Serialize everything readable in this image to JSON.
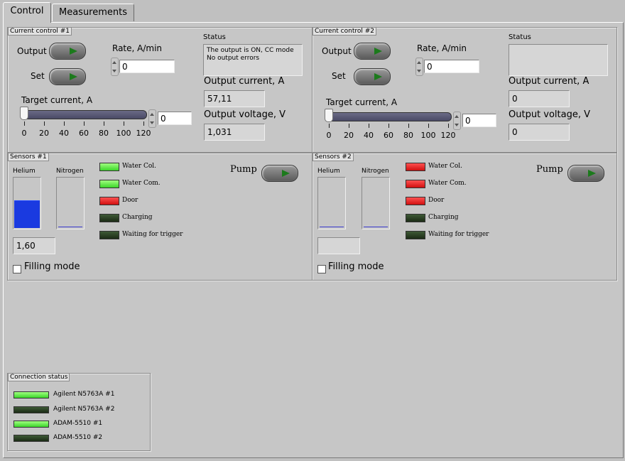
{
  "tabs": [
    {
      "label": "Control",
      "active": true
    },
    {
      "label": "Measurements",
      "active": false
    }
  ],
  "cc1": {
    "title": "Current control #1",
    "output_label": "Output",
    "set_label": "Set",
    "rate_label": "Rate, A/min",
    "rate_value": "0",
    "target_label": "Target current, A",
    "target_value": "0",
    "ticks": [
      "0",
      "20",
      "40",
      "60",
      "80",
      "100",
      "120"
    ],
    "status_label": "Status",
    "status_line1": "The output is ON, CC mode",
    "status_line2": "No output errors",
    "out_current_label": "Output current, A",
    "out_current_value": "57,11",
    "out_voltage_label": "Output voltage, V",
    "out_voltage_value": "1,031"
  },
  "cc2": {
    "title": "Current control #2",
    "output_label": "Output",
    "set_label": "Set",
    "rate_label": "Rate, A/min",
    "rate_value": "0",
    "target_label": "Target current, A",
    "target_value": "0",
    "ticks": [
      "0",
      "20",
      "40",
      "60",
      "80",
      "100",
      "120"
    ],
    "status_label": "Status",
    "status_line1": "",
    "status_line2": "",
    "out_current_label": "Output current, A",
    "out_current_value": "0",
    "out_voltage_label": "Output voltage, V",
    "out_voltage_value": "0"
  },
  "s1": {
    "title": "Sensors #1",
    "helium_label": "Helium",
    "nitrogen_label": "Nitrogen",
    "helium_value": "1,60",
    "pump_label": "Pump",
    "filling_label": "Filling mode",
    "leds": [
      "Water Col.",
      "Water Com.",
      "Door",
      "Charging",
      "Waiting for trigger"
    ],
    "led_states": [
      "green-on",
      "green-on",
      "red-on",
      "off",
      "off"
    ]
  },
  "s2": {
    "title": "Sensors #2",
    "helium_label": "Helium",
    "nitrogen_label": "Nitrogen",
    "helium_value": "",
    "pump_label": "Pump",
    "filling_label": "Filling mode",
    "leds": [
      "Water Col.",
      "Water Com.",
      "Door",
      "Charging",
      "Waiting for trigger"
    ],
    "led_states": [
      "red-on",
      "red-on",
      "red-on",
      "off",
      "off"
    ]
  },
  "conn": {
    "title": "Connection status",
    "items": [
      "Agilent N5763A #1",
      "Agilent N5763A #2",
      "ADAM-5510 #1",
      "ADAM-5510 #2"
    ],
    "states": [
      "green-on",
      "off",
      "green-on",
      "off"
    ]
  },
  "colors": {
    "led_green": "#3cd62a",
    "led_red": "#d01010",
    "led_off": "#1c2c16",
    "tank_blue": "#1a3ae0"
  }
}
